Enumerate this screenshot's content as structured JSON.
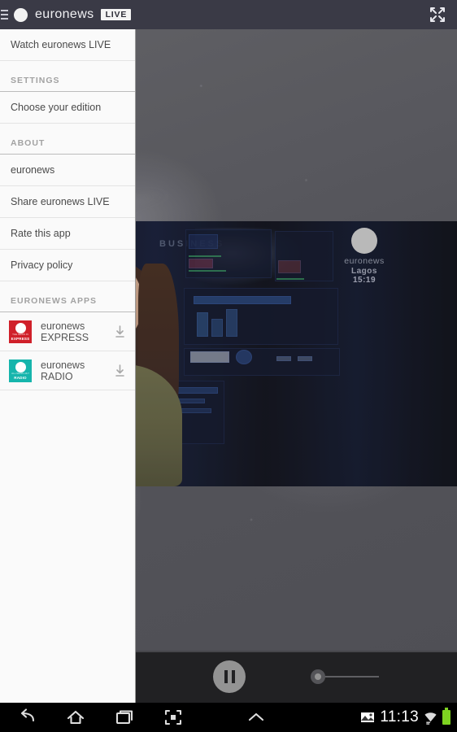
{
  "header": {
    "menu_icon": "hamburger-icon",
    "brand": "euronews",
    "live_badge": "LIVE",
    "expand_icon": "fullscreen-expand-icon"
  },
  "drawer": {
    "primary": [
      {
        "label": "Watch euronews LIVE"
      }
    ],
    "sections": [
      {
        "title": "SETTINGS",
        "items": [
          {
            "label": "Choose your edition"
          }
        ]
      },
      {
        "title": "ABOUT",
        "items": [
          {
            "label": "euronews"
          },
          {
            "label": "Share euronews LIVE"
          },
          {
            "label": "Rate this app"
          },
          {
            "label": "Privacy policy"
          }
        ]
      }
    ],
    "apps_section_title": "EURONEWS APPS",
    "apps": [
      {
        "name": "euronews\nEXPRESS",
        "name_line1": "euronews",
        "name_line2": "EXPRESS",
        "icon_tag": "EXPRESS",
        "icon_sub": "THE NEWS IN",
        "icon_color": "#d0202a",
        "download_icon": "download-icon"
      },
      {
        "name": "euronews RADIO",
        "name_line1": "euronews RADIO",
        "name_line2": "",
        "icon_tag": "RADIO",
        "icon_sub": "ALL NEWS 24/7",
        "icon_color": "#16b5ac",
        "download_icon": "download-icon"
      }
    ]
  },
  "video": {
    "overlay_brand": "euronews",
    "overlay_city": "Lagos",
    "overlay_time": "15:19",
    "backdrop_word": "BUSINESS",
    "placard_text": "BUSINESS"
  },
  "controls": {
    "pause_icon": "pause-icon",
    "slider_value": 0
  },
  "navbar": {
    "back_icon": "back-icon",
    "home_icon": "home-icon",
    "recents_icon": "recent-apps-icon",
    "screenshot_icon": "screenshot-icon",
    "expand_icon": "chevron-up-icon",
    "status_image_icon": "image-icon",
    "clock": "11:13",
    "wifi_icon": "wifi-icon",
    "battery_icon": "battery-icon"
  },
  "colors": {
    "appbar": "#3a3a46",
    "drawer_bg": "#fafafa",
    "accent_red": "#d0202a",
    "accent_teal": "#16b5ac",
    "battery_green": "#7ed321"
  }
}
